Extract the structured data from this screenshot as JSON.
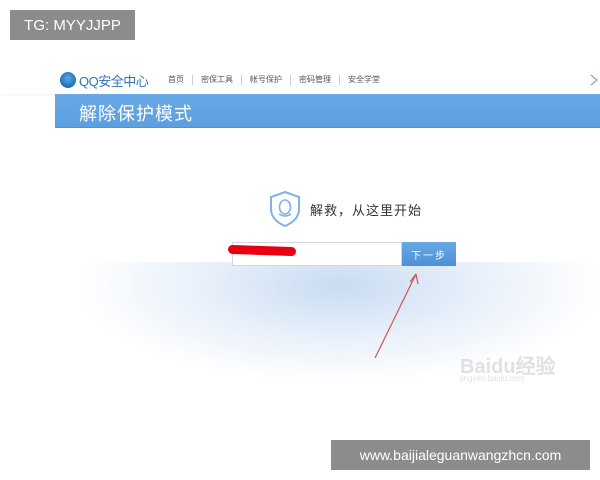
{
  "overlay": {
    "top_left_tag": "TG: MYYJJPP",
    "bottom_right_url": "www.baijialeguanwangzhcn.com"
  },
  "header": {
    "logo_text": "QQ安全中心",
    "nav": [
      "首页",
      "密保工具",
      "帐号保护",
      "密码管理",
      "安全学堂"
    ]
  },
  "banner": {
    "title": "解除保护模式"
  },
  "main": {
    "icon": "shield-qq-icon",
    "headline": "解救，从这里开始",
    "input_value": "",
    "next_label": "下一步"
  },
  "watermark": {
    "main": "Baidu经验",
    "sub": "jingyan.baidu.com"
  },
  "colors": {
    "accent": "#5b9fe0",
    "redaction": "#e60012",
    "arrow": "#d9534f"
  }
}
